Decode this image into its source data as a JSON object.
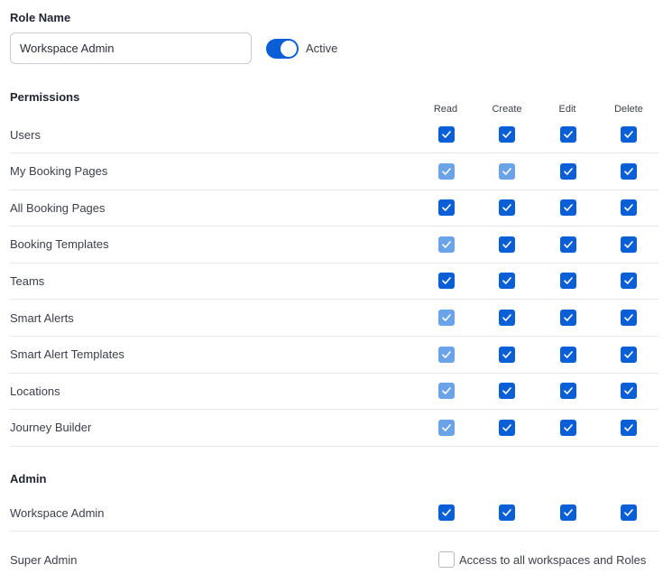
{
  "role": {
    "label": "Role Name",
    "value": "Workspace Admin",
    "active_toggle": {
      "label": "Active",
      "on": true
    }
  },
  "permissions": {
    "title": "Permissions",
    "columns": [
      "Read",
      "Create",
      "Edit",
      "Delete"
    ],
    "rows": [
      {
        "label": "Users",
        "read": "checked",
        "create": "checked",
        "edit": "checked",
        "delete": "checked"
      },
      {
        "label": "My Booking Pages",
        "read": "checked-disabled",
        "create": "checked-disabled",
        "edit": "checked",
        "delete": "checked"
      },
      {
        "label": "All Booking Pages",
        "read": "checked",
        "create": "checked",
        "edit": "checked",
        "delete": "checked"
      },
      {
        "label": "Booking Templates",
        "read": "checked-disabled",
        "create": "checked",
        "edit": "checked",
        "delete": "checked"
      },
      {
        "label": "Teams",
        "read": "checked",
        "create": "checked",
        "edit": "checked",
        "delete": "checked"
      },
      {
        "label": "Smart Alerts",
        "read": "checked-disabled",
        "create": "checked",
        "edit": "checked",
        "delete": "checked"
      },
      {
        "label": "Smart Alert Templates",
        "read": "checked-disabled",
        "create": "checked",
        "edit": "checked",
        "delete": "checked"
      },
      {
        "label": "Locations",
        "read": "checked-disabled",
        "create": "checked",
        "edit": "checked",
        "delete": "checked"
      },
      {
        "label": "Journey Builder",
        "read": "checked-disabled",
        "create": "checked",
        "edit": "checked",
        "delete": "checked"
      }
    ]
  },
  "admin": {
    "title": "Admin",
    "workspace_admin": {
      "label": "Workspace Admin",
      "read": "checked",
      "create": "checked",
      "edit": "checked",
      "delete": "checked"
    },
    "super_admin": {
      "label": "Super Admin",
      "checkbox": "unchecked",
      "checkbox_label": "Access to all workspaces and Roles"
    }
  },
  "colors": {
    "accent": "#0a5fd7",
    "accent_disabled": "#6aa3e8",
    "divider": "#e4e6ea"
  }
}
